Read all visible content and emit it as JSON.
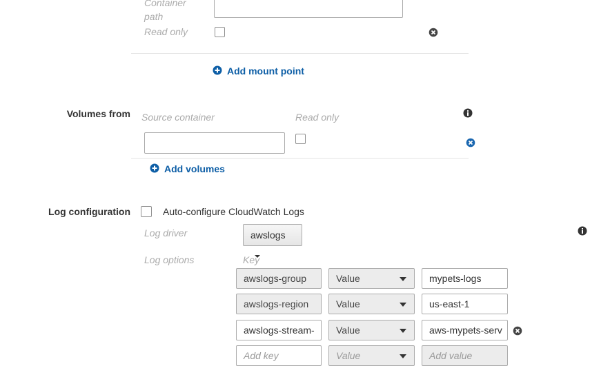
{
  "mount_points": {
    "container_path_label": "Container path",
    "read_only_label": "Read only",
    "add_link": "Add mount point"
  },
  "volumes_from": {
    "section_label": "Volumes from",
    "source_container_label": "Source container",
    "read_only_label": "Read only",
    "source_container_value": "",
    "add_link": "Add volumes"
  },
  "log_configuration": {
    "section_label": "Log configuration",
    "auto_configure_label": "Auto-configure CloudWatch Logs",
    "log_driver_label": "Log driver",
    "log_driver_value": "awslogs",
    "log_options_label": "Log options",
    "key_header": "Key",
    "options": [
      {
        "key": "awslogs-group",
        "type": "Value",
        "value": "mypets-logs"
      },
      {
        "key": "awslogs-region",
        "type": "Value",
        "value": "us-east-1"
      },
      {
        "key": "awslogs-stream-",
        "type": "Value",
        "value": "aws-mypets-serv"
      }
    ],
    "new_option": {
      "key_placeholder": "Add key",
      "type": "Value",
      "value_placeholder": "Add value"
    }
  },
  "colors": {
    "link": "#0d5ea6",
    "remove_icon_blue": "#1a67b0",
    "remove_icon_dark": "#444444"
  },
  "icons": [
    "remove-icon",
    "add-circle-icon",
    "info-icon"
  ]
}
